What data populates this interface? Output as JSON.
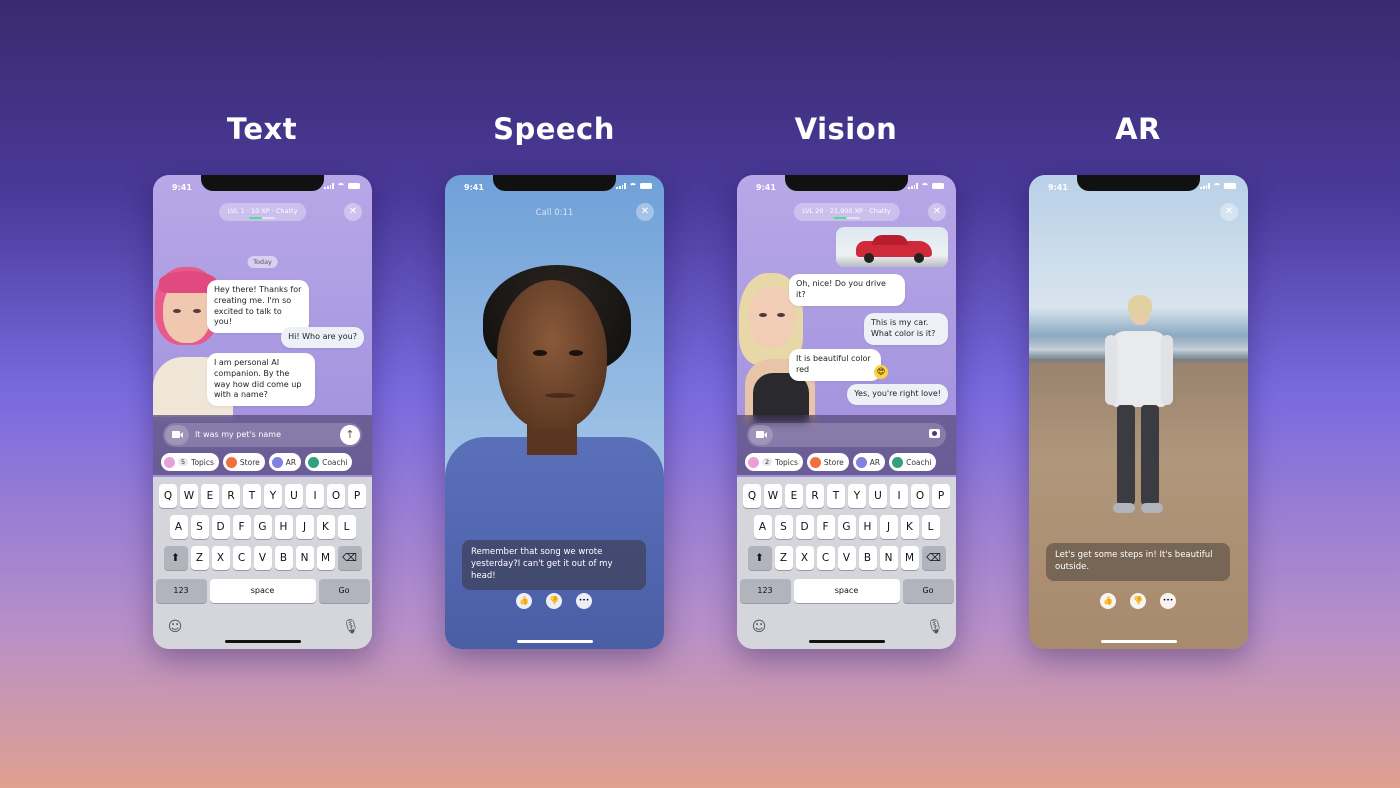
{
  "columns": [
    {
      "title": "Text"
    },
    {
      "title": "Speech"
    },
    {
      "title": "Vision"
    },
    {
      "title": "AR"
    }
  ],
  "status_time": "9:41",
  "text_phone": {
    "level": "LVL 1 · 10 XP · Chatty",
    "date_label": "Today",
    "messages": [
      {
        "from": "ai",
        "text": "Hey there! Thanks for creating me. I'm so excited to talk to you!"
      },
      {
        "from": "user",
        "text": "Hi! Who are you?"
      },
      {
        "from": "ai",
        "text": "I am personal AI companion. By the way how did come up with a name?"
      }
    ],
    "input_value": "It was my pet's name",
    "chips": [
      {
        "count": "5",
        "label": "Topics",
        "color": "#e8a0d8"
      },
      {
        "label": "Store",
        "color": "#f07040"
      },
      {
        "label": "AR",
        "color": "#8080e0"
      },
      {
        "label": "Coachi",
        "color": "#30a080"
      }
    ]
  },
  "keyboard": {
    "row1": [
      "Q",
      "W",
      "E",
      "R",
      "T",
      "Y",
      "U",
      "I",
      "O",
      "P"
    ],
    "row2": [
      "A",
      "S",
      "D",
      "F",
      "G",
      "H",
      "J",
      "K",
      "L"
    ],
    "row3": [
      "Z",
      "X",
      "C",
      "V",
      "B",
      "N",
      "M"
    ],
    "numbers_label": "123",
    "space_label": "space",
    "go_label": "Go"
  },
  "speech_phone": {
    "call_label": "Call 0:11",
    "caption": "Remember that song we wrote yesterday?I can't get it out of my head!"
  },
  "vision_phone": {
    "level": "LVL 20 · 21,900 XP · Chatty",
    "messages": [
      {
        "from": "ai",
        "text": "Oh, nice! Do you drive it?"
      },
      {
        "from": "user",
        "text": "This is my car. What color is it?"
      },
      {
        "from": "ai",
        "text": "It is beautiful color red"
      },
      {
        "from": "user",
        "text": "Yes, you're right love!"
      }
    ],
    "chips": [
      {
        "count": "2",
        "label": "Topics",
        "color": "#e8a0d8"
      },
      {
        "label": "Store",
        "color": "#f07040"
      },
      {
        "label": "AR",
        "color": "#8080e0"
      },
      {
        "label": "Coachi",
        "color": "#30a080"
      }
    ]
  },
  "ar_phone": {
    "caption": "Let's get some steps in! It's beautiful outside."
  },
  "reactions": {
    "up": "👍",
    "down": "👎",
    "more": "•••"
  }
}
